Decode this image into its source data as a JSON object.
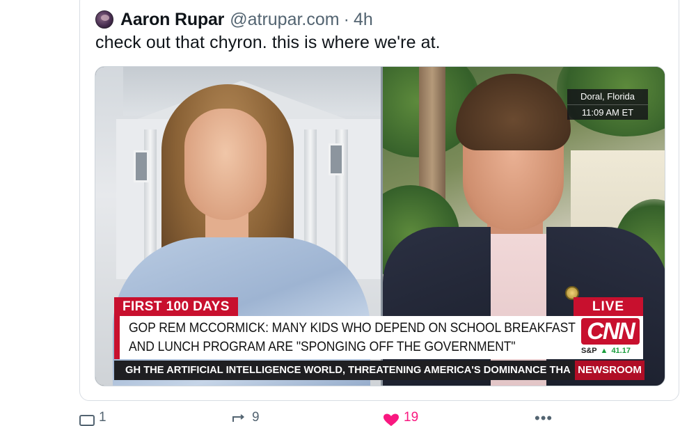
{
  "quoted_post": {
    "author_name": "Aaron Rupar",
    "author_handle": "@atrupar.com",
    "separator": "·",
    "time_ago": "4h",
    "text": "check out that chyron. this is where we're at."
  },
  "media": {
    "location_line1": "Doral, Florida",
    "location_line2": "11:09 AM ET",
    "chyron_tag": "FIRST 100 DAYS",
    "live_tag": "LIVE",
    "headline_line1": "GOP REM MCCORMICK: MANY KIDS WHO DEPEND ON SCHOOL BREAKFAST",
    "headline_line2": "AND LUNCH PROGRAM ARE \"SPONGING OFF THE GOVERNMENT\"",
    "network_logo": "CNN",
    "market_label": "S&P",
    "market_arrow": "▲",
    "market_value": "41.17",
    "ticker_text": "GH THE ARTIFICIAL INTELLIGENCE WORLD, THREATENING AMERICA'S DOMINANCE THA",
    "program_tag": "NEWSROOM"
  },
  "actions": {
    "reply_count": "1",
    "repost_count": "9",
    "like_count": "19",
    "like_color": "#f91880"
  }
}
